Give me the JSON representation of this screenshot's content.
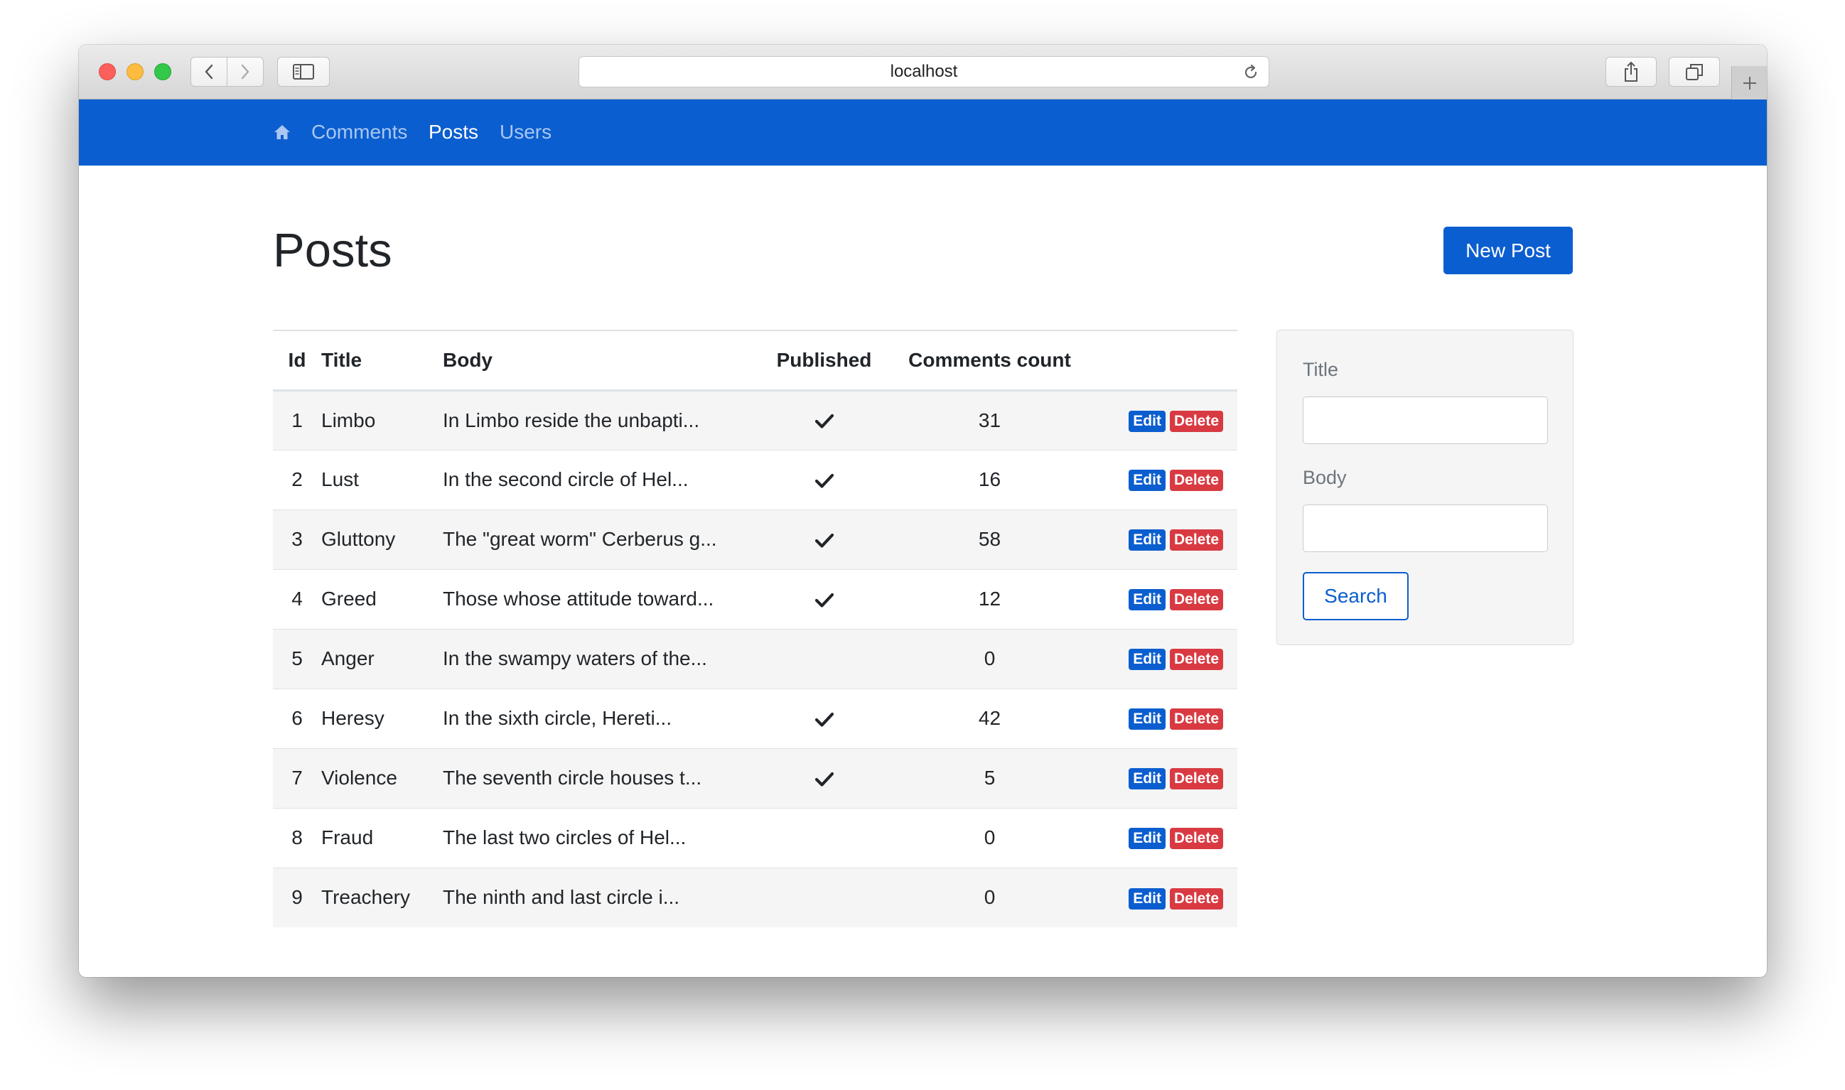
{
  "browser": {
    "url": "localhost"
  },
  "navbar": {
    "home_icon": "home-icon",
    "links": [
      {
        "label": "Comments",
        "active": false
      },
      {
        "label": "Posts",
        "active": true
      },
      {
        "label": "Users",
        "active": false
      }
    ]
  },
  "page": {
    "title": "Posts",
    "new_button": "New Post"
  },
  "table": {
    "columns": [
      "Id",
      "Title",
      "Body",
      "Published",
      "Comments count",
      ""
    ],
    "rows": [
      {
        "id": "1",
        "title": "Limbo",
        "body": "In Limbo reside the unbapti...",
        "published": true,
        "comments": "31"
      },
      {
        "id": "2",
        "title": "Lust",
        "body": "In the second circle of Hel...",
        "published": true,
        "comments": "16"
      },
      {
        "id": "3",
        "title": "Gluttony",
        "body": "The \"great worm\" Cerberus g...",
        "published": true,
        "comments": "58"
      },
      {
        "id": "4",
        "title": "Greed",
        "body": "Those whose attitude toward...",
        "published": true,
        "comments": "12"
      },
      {
        "id": "5",
        "title": "Anger",
        "body": "In the swampy waters of the...",
        "published": false,
        "comments": "0"
      },
      {
        "id": "6",
        "title": "Heresy",
        "body": "In the sixth circle, Hereti...",
        "published": true,
        "comments": "42"
      },
      {
        "id": "7",
        "title": "Violence",
        "body": "The seventh circle houses t...",
        "published": true,
        "comments": "5"
      },
      {
        "id": "8",
        "title": "Fraud",
        "body": "The last two circles of Hel...",
        "published": false,
        "comments": "0"
      },
      {
        "id": "9",
        "title": "Treachery",
        "body": "The ninth and last circle i...",
        "published": false,
        "comments": "0"
      }
    ],
    "edit_label": "Edit",
    "delete_label": "Delete"
  },
  "search": {
    "title_label": "Title",
    "title_value": "",
    "body_label": "Body",
    "body_value": "",
    "button": "Search"
  },
  "colors": {
    "primary": "#0b5ecf",
    "danger": "#d93a42"
  }
}
